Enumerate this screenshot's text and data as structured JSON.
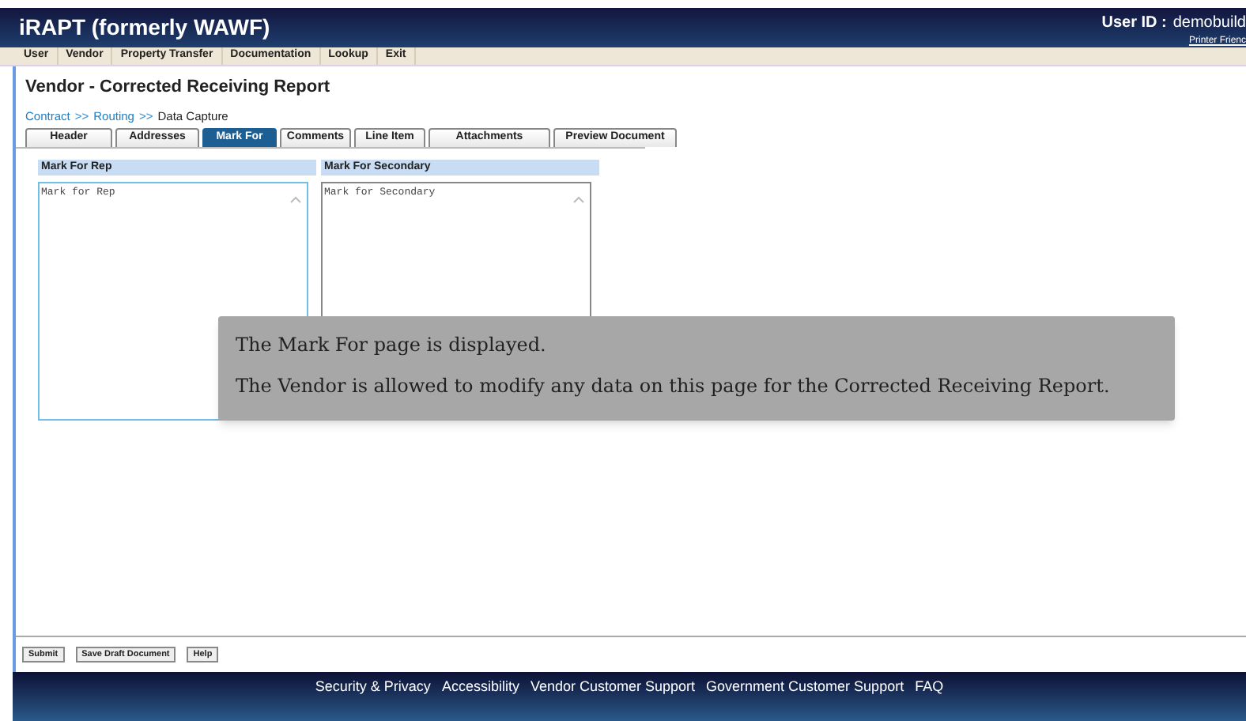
{
  "header": {
    "title": "iRAPT (formerly WAWF)",
    "user_id_label": "User ID :",
    "user_id": "demobuild",
    "printer_link": "Printer Frienc"
  },
  "menu": [
    "User",
    "Vendor",
    "Property Transfer",
    "Documentation",
    "Lookup",
    "Exit"
  ],
  "page_title": "Vendor - Corrected Receiving Report",
  "breadcrumb": [
    {
      "label": "Contract",
      "kind": "link"
    },
    {
      "label": ">>",
      "kind": "separator"
    },
    {
      "label": "Routing",
      "kind": "link"
    },
    {
      "label": ">>",
      "kind": "separator"
    },
    {
      "label": "Data Capture",
      "kind": "current"
    }
  ],
  "tabs": [
    {
      "label": "Header",
      "selected": false
    },
    {
      "label": "Addresses",
      "selected": false
    },
    {
      "label": "Mark For",
      "selected": true
    },
    {
      "label": "Comments",
      "selected": false
    },
    {
      "label": "Line Item",
      "selected": false
    },
    {
      "label": "Attachments",
      "selected": false
    },
    {
      "label": "Preview Document",
      "selected": false
    }
  ],
  "fields": [
    {
      "label": "Mark For Rep",
      "value": "Mark for Rep",
      "focused": true
    },
    {
      "label": "Mark For Secondary",
      "value": "Mark for Secondary",
      "focused": false
    }
  ],
  "buttons": [
    "Submit",
    "Save Draft Document",
    "Help"
  ],
  "footer_links": [
    "Security & Privacy",
    "Accessibility",
    "Vendor Customer Support",
    "Government Customer Support",
    "FAQ"
  ],
  "callout": [
    "The Mark For page is displayed.",
    "The Vendor is allowed to modify any data on this page for the Corrected Receiving Report."
  ]
}
